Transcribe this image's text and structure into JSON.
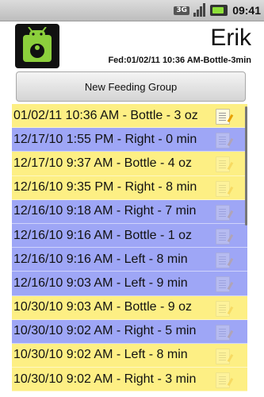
{
  "status": {
    "network": "3G",
    "time": "09:41"
  },
  "header": {
    "name": "Erik",
    "fed": "Fed:01/02/11 10:36 AM-Bottle-3min"
  },
  "button": {
    "new_group": "New Feeding Group"
  },
  "feedings": [
    {
      "text": "01/02/11 10:36 AM - Bottle - 3 oz",
      "color": "yellow",
      "note": "active"
    },
    {
      "text": "12/17/10 1:55 PM - Right - 0 min",
      "color": "blue",
      "note": "faded"
    },
    {
      "text": "12/17/10 9:37 AM - Bottle - 4 oz",
      "color": "yellow",
      "note": "faded"
    },
    {
      "text": "12/16/10 9:35 PM - Right - 8 min",
      "color": "yellow",
      "note": "faded"
    },
    {
      "text": "12/16/10 9:18 AM - Right - 7 min",
      "color": "blue",
      "note": "faded"
    },
    {
      "text": "12/16/10 9:16 AM - Bottle - 1 oz",
      "color": "blue",
      "note": "faded"
    },
    {
      "text": "12/16/10 9:16 AM - Left - 8 min",
      "color": "blue",
      "note": "faded"
    },
    {
      "text": "12/16/10 9:03 AM - Left - 9 min",
      "color": "blue",
      "note": "faded"
    },
    {
      "text": "10/30/10 9:03 AM - Bottle - 9 oz",
      "color": "yellow",
      "note": "faded"
    },
    {
      "text": "10/30/10 9:02 AM - Right - 5 min",
      "color": "blue",
      "note": "faded"
    },
    {
      "text": "10/30/10 9:02 AM - Left - 8 min",
      "color": "yellow",
      "note": "faded"
    },
    {
      "text": "10/30/10 9:02 AM - Right - 3 min",
      "color": "yellow",
      "note": "faded"
    }
  ]
}
